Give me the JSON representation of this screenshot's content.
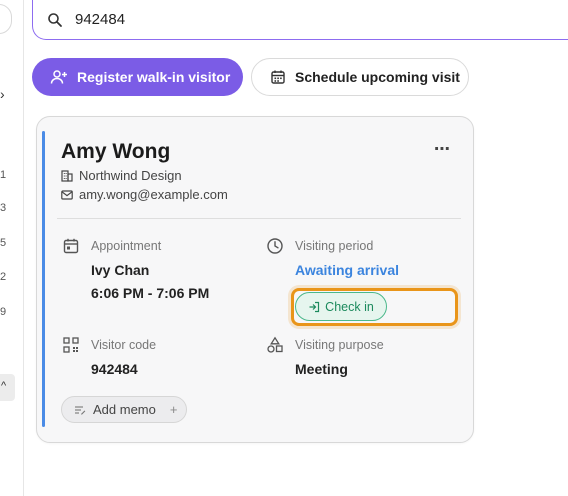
{
  "left_rail": {
    "nums": [
      "1",
      "3",
      "5",
      "2",
      "9"
    ],
    "active_glyph": "^"
  },
  "search": {
    "value": "942484",
    "icon": "search-icon"
  },
  "actions": {
    "register_label": "Register walk-in visitor",
    "schedule_label": "Schedule upcoming visit"
  },
  "visitor": {
    "name": "Amy Wong",
    "company": "Northwind Design",
    "email": "amy.wong@example.com",
    "more_label": "⋯",
    "appointment_label": "Appointment",
    "host": "Ivy Chan",
    "time": "6:06 PM - 7:06 PM",
    "period_label": "Visiting period",
    "period_status": "Awaiting arrival",
    "checkin_label": "Check in",
    "code_label": "Visitor code",
    "code": "942484",
    "purpose_label": "Visiting purpose",
    "purpose": "Meeting",
    "memo_label": "Add memo",
    "memo_plus": "+"
  },
  "colors": {
    "accent_purple": "#7b5ce6",
    "accent_blue": "#4a8be6",
    "link_blue": "#3b84de",
    "checkin_green": "#1c8a5d",
    "focus_orange": "#e9951a"
  }
}
